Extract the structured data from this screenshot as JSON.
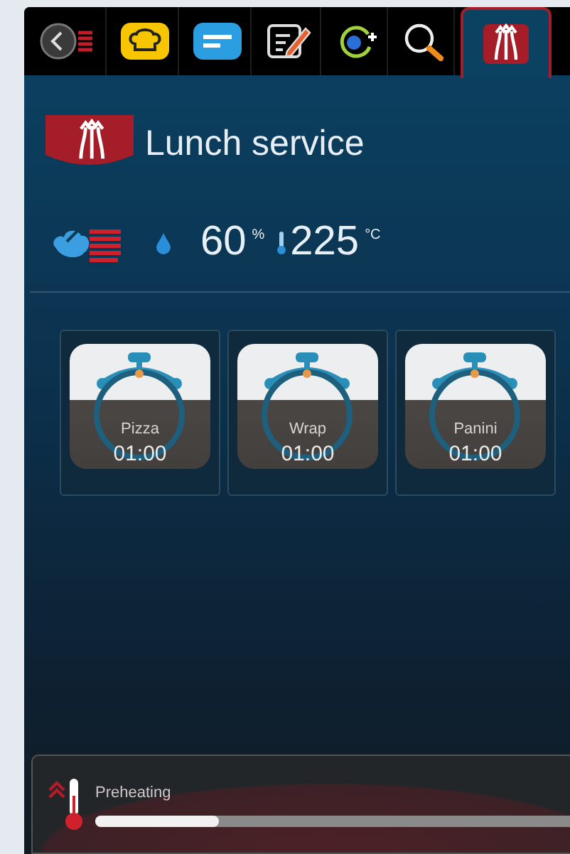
{
  "toolbar": [
    {
      "kind": "back",
      "selected": false
    },
    {
      "kind": "chef",
      "selected": false
    },
    {
      "kind": "notes",
      "selected": false
    },
    {
      "kind": "edit",
      "selected": false
    },
    {
      "kind": "refresh",
      "selected": false
    },
    {
      "kind": "search",
      "selected": false
    },
    {
      "kind": "program",
      "selected": true
    }
  ],
  "title": "Lunch service",
  "climate": {
    "humidity": "60",
    "humidity_unit": "%",
    "temperature": "225",
    "temperature_unit": "°C"
  },
  "programs": [
    {
      "name": "Pizza",
      "time": "01:00"
    },
    {
      "name": "Wrap",
      "time": "01:00"
    },
    {
      "name": "Panini",
      "time": "01:00"
    }
  ],
  "status": {
    "label": "Preheating",
    "level": 0.26
  }
}
